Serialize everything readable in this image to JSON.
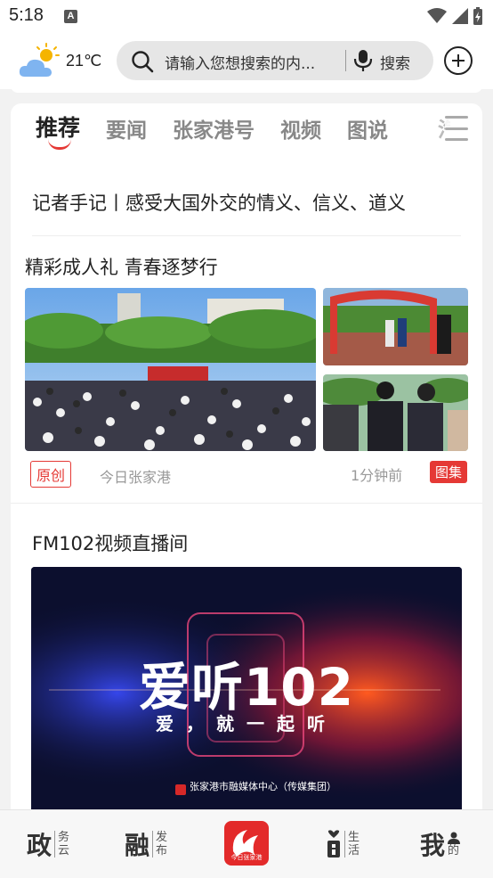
{
  "status": {
    "time": "5:18",
    "notification_icon": "A"
  },
  "header": {
    "temperature": "21℃",
    "weather_icon": "partly-sunny-icon",
    "search": {
      "placeholder": "请输入您想搜索的内...",
      "button_label": "搜索"
    }
  },
  "tabs": [
    {
      "label": "推荐",
      "active": true
    },
    {
      "label": "要闻",
      "active": false
    },
    {
      "label": "张家港号",
      "active": false
    },
    {
      "label": "视频",
      "active": false
    },
    {
      "label": "图说",
      "active": false
    }
  ],
  "tab_overflow_partial": "汽",
  "headline": "记者手记丨感受大国外交的情义、信义、道义",
  "article": {
    "title": "精彩成人礼 青春逐梦行",
    "badge": "原创",
    "source": "今日张家港",
    "time_ago": "1分钟前",
    "type_badge": "图集"
  },
  "live": {
    "title": "FM102视频直播间",
    "banner_title": "爱听102",
    "banner_subtitle": "爱，就一起听",
    "banner_footer": "张家港市融媒体中心（传媒集团）"
  },
  "bottom_nav": [
    {
      "big": "政",
      "small_top": "务",
      "small_bottom": "云"
    },
    {
      "big": "融",
      "small_top": "发",
      "small_bottom": "布"
    },
    {
      "logo_text": "今日张家港"
    },
    {
      "small_top": "生",
      "small_bottom": "活"
    },
    {
      "big": "我",
      "small_bottom": "的"
    }
  ],
  "colors": {
    "accent": "#e53935",
    "search_bg": "#e6e6e6"
  }
}
